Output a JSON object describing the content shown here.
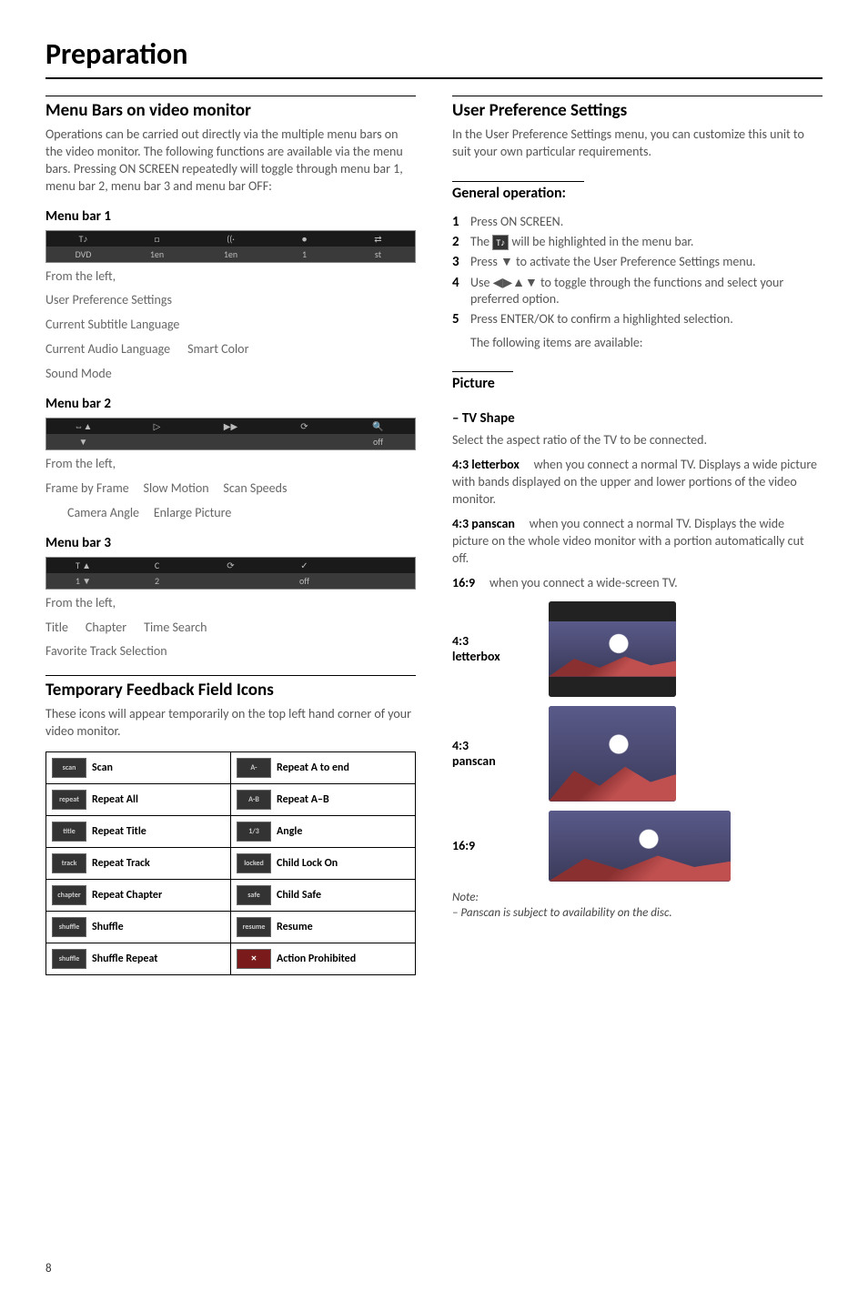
{
  "page": {
    "title": "Preparation",
    "number": "8"
  },
  "left": {
    "section1": {
      "heading": "Menu Bars on video monitor",
      "intro": "Operations can be carried out directly via the multiple menu bars on the video monitor. The following functions are available via the menu bars. Pressing ON SCREEN repeatedly will toggle through menu bar 1, menu bar 2, menu bar 3 and menu bar OFF:",
      "mb1": {
        "heading": "Menu bar 1",
        "row_top": [
          "T♪",
          "□",
          "((·",
          "●",
          "⇄"
        ],
        "row_bot": [
          "DVD",
          "1en",
          "1en",
          "1",
          "st"
        ],
        "from": "From the left,",
        "l1": "User Preference Settings",
        "l2": "Current Subtitle Language",
        "l3a": "Current Audio Language",
        "l3b": "Smart Color",
        "l4": "Sound Mode"
      },
      "mb2": {
        "heading": "Menu bar 2",
        "row_top": [
          "⇔▲",
          "▷",
          "▶▶",
          "⟳",
          "🔍"
        ],
        "row_bot": [
          "▼",
          "",
          "",
          "",
          "off"
        ],
        "from": "From the left,",
        "l1a": "Frame by Frame",
        "l1b": "Slow Motion",
        "l1c": "Scan Speeds",
        "l2a": "Camera Angle",
        "l2b": "Enlarge Picture"
      },
      "mb3": {
        "heading": "Menu bar 3",
        "row_top": [
          "T ▲",
          "C",
          "⟳",
          "✓",
          ""
        ],
        "row_bot": [
          "1 ▼",
          "2",
          "",
          "off",
          ""
        ],
        "from": "From the left,",
        "l1a": "Title",
        "l1b": "Chapter",
        "l1c": "Time Search",
        "l2": "Favorite Track Selection"
      }
    },
    "section2": {
      "heading": "Temporary Feedback Field Icons",
      "intro": "These icons will appear temporarily on the top left hand corner of your video monitor.",
      "rows": [
        {
          "li": "scan",
          "ll": "Scan",
          "ri": "A-",
          "rl": "Repeat A to end"
        },
        {
          "li": "repeat",
          "ll": "Repeat All",
          "ri": "A-B",
          "rl": "Repeat A–B"
        },
        {
          "li": "title",
          "ll": "Repeat Title",
          "ri": "1/3",
          "rl": "Angle"
        },
        {
          "li": "track",
          "ll": "Repeat Track",
          "ri": "locked",
          "rl": "Child Lock On"
        },
        {
          "li": "chapter",
          "ll": "Repeat Chapter",
          "ri": "safe",
          "rl": "Child Safe"
        },
        {
          "li": "shuffle",
          "ll": "Shuffle",
          "ri": "resume",
          "rl": "Resume"
        },
        {
          "li": "shuffle",
          "ll": "Shuffle Repeat",
          "ri": "✕",
          "rl": "Action Prohibited",
          "red": true
        }
      ]
    }
  },
  "right": {
    "section1": {
      "heading": "User Preference Settings",
      "intro": "In the User Preference Settings menu, you can customize this unit to suit your own particular requirements."
    },
    "general": {
      "heading": "General operation:",
      "steps": [
        "Press ON SCREEN.",
        "The __ICON__ will be highlighted in the menu bar.",
        "Press ▼ to activate the User Preference Settings menu.",
        "Use ◀▶▲▼ to toggle through the functions and select your preferred option.",
        "Press ENTER/OK to confirm a highlighted selection."
      ],
      "tail": "The following items are available:"
    },
    "picture": {
      "heading": "Picture",
      "tvshape_heading": "–  TV Shape",
      "tvshape_intro": "Select the aspect ratio of the TV to be connected.",
      "opt1_label": "4:3 letterbox",
      "opt1_body": "when you connect a normal TV. Displays a wide picture with bands displayed on the upper and lower portions of the video monitor.",
      "opt2_label": "4:3 panscan",
      "opt2_body": "when you connect a normal TV. Displays the wide picture on the whole video monitor with a portion automatically cut off.",
      "opt3_label": "16:9",
      "opt3_body": "when you connect a wide-screen TV.",
      "shape_labels": {
        "lb": "4:3\nletterbox",
        "ps": "4:3\npanscan",
        "ws": "16:9"
      },
      "note_h": "Note:",
      "note_b": "–  Panscan is subject to availability on the disc."
    }
  }
}
